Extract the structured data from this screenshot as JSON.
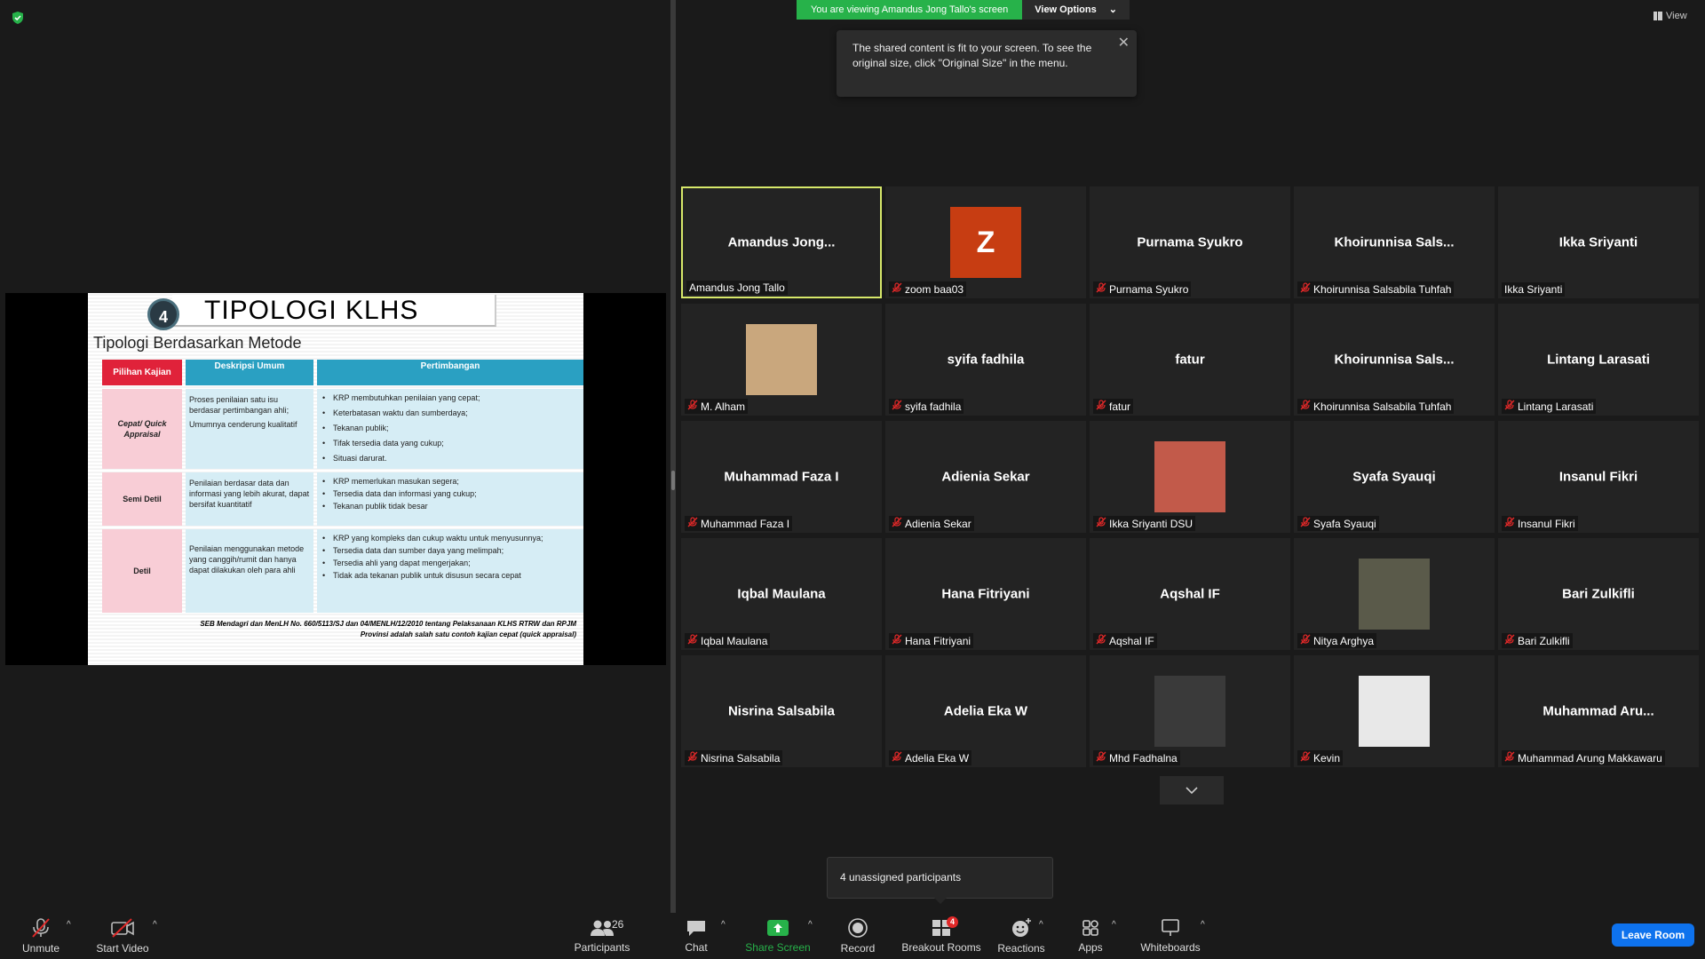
{
  "colors": {
    "accent_green": "#27b24a",
    "active_speaker_border": "#d7e86a",
    "leave_blue": "#0e72ed",
    "avatar_z": "#c73d12",
    "mic_off_red": "#e02828"
  },
  "banner": {
    "text": "You are viewing Amandus Jong Tallo's screen",
    "view_options": "View Options"
  },
  "tooltip": {
    "text": "The shared content is fit to your screen. To see the original size, click \"Original Size\" in the menu."
  },
  "view_button": "View",
  "slide": {
    "number": "4",
    "title": "TIPOLOGI  KLHS",
    "subtitle": "Tipologi Berdasarkan Metode",
    "headers": [
      "Pilihan Kajian",
      "Deskripsi Umum",
      "Pertimbangan"
    ],
    "rows": [
      {
        "kajian": "Cepat/ Quick Appraisal",
        "deskripsi": [
          "Proses penilaian satu isu berdasar pertimbangan ahli;",
          "Umumnya cenderung kualitatif"
        ],
        "pertimbangan": [
          "KRP membutuhkan penilaian yang cepat;",
          "Keterbatasan waktu dan sumberdaya;",
          "Tekanan publik;",
          "Tifak tersedia data yang cukup;",
          "Situasi darurat."
        ]
      },
      {
        "kajian": "Semi Detil",
        "deskripsi": [
          "Penilaian berdasar data dan informasi yang lebih akurat, dapat bersifat kuantitatif"
        ],
        "pertimbangan": [
          "KRP memerlukan masukan segera;",
          "Tersedia data dan informasi yang cukup;",
          "Tekanan publik tidak besar"
        ]
      },
      {
        "kajian": "Detil",
        "deskripsi": [
          "Penilaian menggunakan metode yang canggih/rumit dan hanya dapat dilakukan oleh para ahli"
        ],
        "pertimbangan": [
          "KRP yang kompleks dan cukup waktu untuk menyusunnya;",
          "Tersedia data dan sumber daya yang melimpah;",
          "Tersedia ahli yang dapat mengerjakan;",
          "Tidak ada tekanan publik untuk disusun secara cepat"
        ]
      }
    ],
    "footer_line1": "SEB Mendagri dan MenLH No. 660/5113/SJ dan 04/MENLH/12/2010 tentang Pelaksanaan KLHS RTRW dan RPJM",
    "footer_line2": "Provinsi adalah salah satu contoh kajian cepat (quick appraisal)"
  },
  "participants_grid": [
    {
      "display": "Amandus  Jong...",
      "label": "Amandus Jong Tallo",
      "muted": false,
      "active": true,
      "avatar": "none"
    },
    {
      "display": "",
      "label": "zoom baa03",
      "muted": true,
      "avatar": "letter",
      "letter": "Z"
    },
    {
      "display": "Purnama Syukro",
      "label": "Purnama Syukro",
      "muted": true,
      "avatar": "none"
    },
    {
      "display": "Khoirunnisa  Sals...",
      "label": "Khoirunnisa Salsabila Tuhfah",
      "muted": true,
      "avatar": "none"
    },
    {
      "display": "Ikka Sriyanti",
      "label": "Ikka Sriyanti",
      "muted": false,
      "avatar": "none"
    },
    {
      "display": "",
      "label": "M. Alham",
      "muted": true,
      "avatar": "photo",
      "photo_color": "#c9a77d"
    },
    {
      "display": "syifa fadhila",
      "label": "syifa fadhila",
      "muted": true,
      "avatar": "none"
    },
    {
      "display": "fatur",
      "label": "fatur",
      "muted": true,
      "avatar": "none"
    },
    {
      "display": "Khoirunnisa  Sals...",
      "label": "Khoirunnisa Salsabila Tuhfah",
      "muted": true,
      "avatar": "none"
    },
    {
      "display": "Lintang Larasati",
      "label": "Lintang Larasati",
      "muted": true,
      "avatar": "none"
    },
    {
      "display": "Muhammad Faza I",
      "label": "Muhammad Faza I",
      "muted": true,
      "avatar": "none"
    },
    {
      "display": "Adienia Sekar",
      "label": "Adienia Sekar",
      "muted": true,
      "avatar": "none"
    },
    {
      "display": "",
      "label": "Ikka Sriyanti DSU",
      "muted": true,
      "avatar": "photo",
      "photo_color": "#c25a4a"
    },
    {
      "display": "Syafa Syauqi",
      "label": "Syafa Syauqi",
      "muted": true,
      "avatar": "none"
    },
    {
      "display": "Insanul Fikri",
      "label": "Insanul Fikri",
      "muted": true,
      "avatar": "none"
    },
    {
      "display": "Iqbal Maulana",
      "label": "Iqbal Maulana",
      "muted": true,
      "avatar": "none"
    },
    {
      "display": "Hana Fitriyani",
      "label": "Hana Fitriyani",
      "muted": true,
      "avatar": "none"
    },
    {
      "display": "Aqshal IF",
      "label": "Aqshal IF",
      "muted": true,
      "avatar": "none"
    },
    {
      "display": "",
      "label": "Nitya Arghya",
      "muted": true,
      "avatar": "photo",
      "photo_color": "#5a5a4a"
    },
    {
      "display": "Bari Zulkifli",
      "label": "Bari Zulkifli",
      "muted": true,
      "avatar": "none"
    },
    {
      "display": "Nisrina Salsabila",
      "label": "Nisrina Salsabila",
      "muted": true,
      "avatar": "none"
    },
    {
      "display": "Adelia Eka W",
      "label": "Adelia Eka W",
      "muted": true,
      "avatar": "none"
    },
    {
      "display": "",
      "label": "Mhd Fadhalna",
      "muted": true,
      "avatar": "photo",
      "photo_color": "#3a3a3a"
    },
    {
      "display": "",
      "label": "Kevin",
      "muted": true,
      "avatar": "photo",
      "photo_color": "#e8e8e8"
    },
    {
      "display": "Muhammad  Aru...",
      "label": "Muhammad Arung Makkawaru",
      "muted": true,
      "avatar": "none"
    }
  ],
  "breakout_toast": "4 unassigned participants",
  "toolbar": {
    "unmute": "Unmute",
    "start_video": "Start Video",
    "participants": "Participants",
    "participants_count": "26",
    "chat": "Chat",
    "share_screen": "Share Screen",
    "record": "Record",
    "breakout_rooms": "Breakout Rooms",
    "breakout_badge": "4",
    "reactions": "Reactions",
    "apps": "Apps",
    "whiteboards": "Whiteboards",
    "leave": "Leave Room"
  }
}
